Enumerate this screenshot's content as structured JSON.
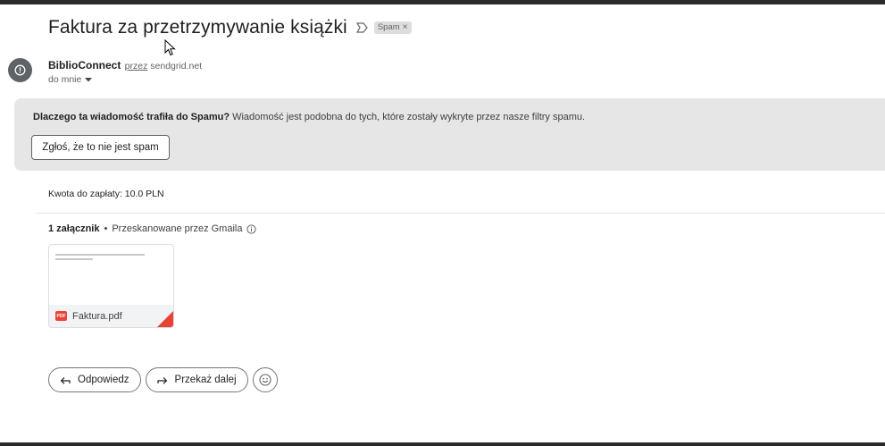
{
  "email": {
    "subject": "Faktura za przetrzymywanie książki",
    "label_chip": "Spam",
    "label_chip_close": "×"
  },
  "sender": {
    "name": "BiblioConnect",
    "via_word": "przez",
    "via_domain": "sendgrid.net",
    "recipient": "do mnie"
  },
  "spam_notice": {
    "question": "Dlaczego ta wiadomość trafiła do Spamu?",
    "explanation": "Wiadomość jest podobna do tych, które zostały wykryte przez nasze filtry spamu.",
    "button": "Zgłoś, że to nie jest spam"
  },
  "body": {
    "text": "Kwota do zapłaty: 10.0 PLN"
  },
  "attachments": {
    "count_label": "1 załącznik",
    "separator": "•",
    "scanned_label": "Przeskanowane przez Gmaila",
    "items": [
      {
        "name": "Faktura.pdf",
        "type_badge": "PDF",
        "icon": "pdf-icon"
      }
    ]
  },
  "actions": {
    "reply": "Odpowiedz",
    "forward": "Przekaż dalej",
    "emoji_icon": "smiley-icon"
  },
  "colors": {
    "spam_panel_bg": "#e6e6e6",
    "pdf_red": "#ea4335",
    "avatar_bg": "#5f6368"
  }
}
